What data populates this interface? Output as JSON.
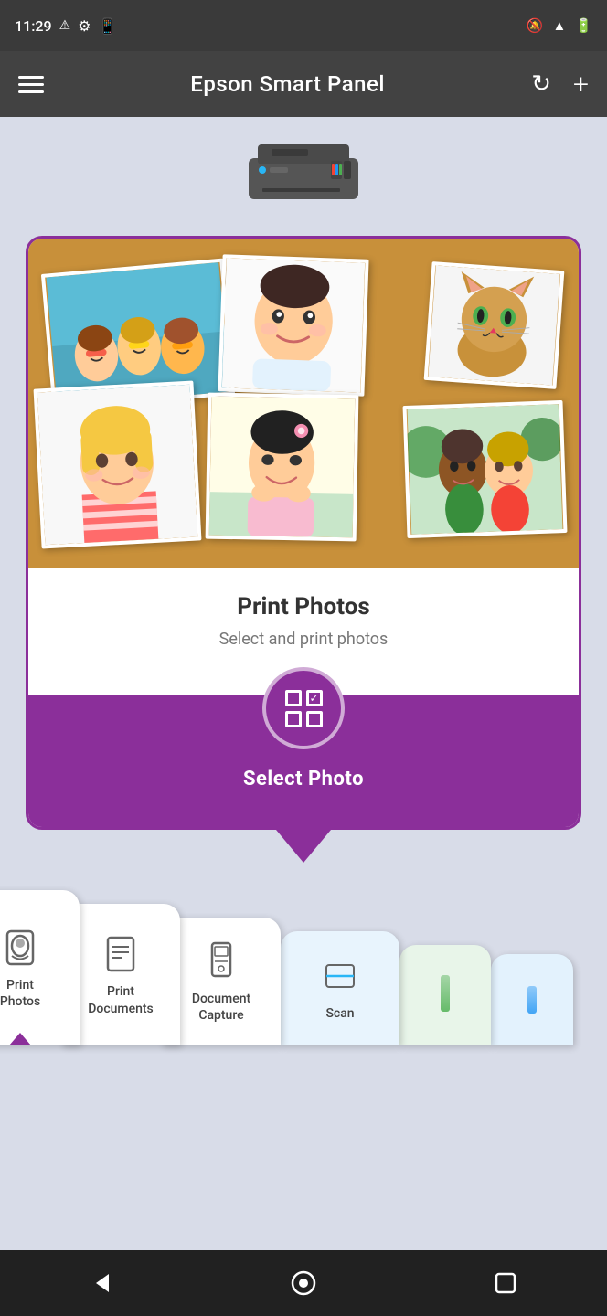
{
  "statusBar": {
    "time": "11:29",
    "warningIcon": "⚠",
    "settingsIcon": "⚙",
    "phoneIcon": "📱",
    "muteIcon": "🔕",
    "wifiIcon": "wifi",
    "batteryIcon": "battery"
  },
  "appBar": {
    "title": "Epson Smart Panel",
    "menuIcon": "hamburger",
    "refreshIcon": "↻",
    "addIcon": "+"
  },
  "card": {
    "title": "Print Photos",
    "subtitle": "Select and print photos",
    "selectButtonLabel": "Select Photo"
  },
  "tabs": [
    {
      "label": "Print\nPhotos",
      "icon": "person"
    },
    {
      "label": "Print\nDocuments",
      "icon": "document"
    },
    {
      "label": "Document\nCapture",
      "icon": "phone"
    },
    {
      "label": "Scan",
      "icon": "scan"
    },
    {
      "label": "",
      "icon": ""
    },
    {
      "label": "",
      "icon": ""
    }
  ],
  "bottomNav": {
    "backIcon": "◀",
    "homeIcon": "⬤",
    "squareIcon": "▪"
  }
}
